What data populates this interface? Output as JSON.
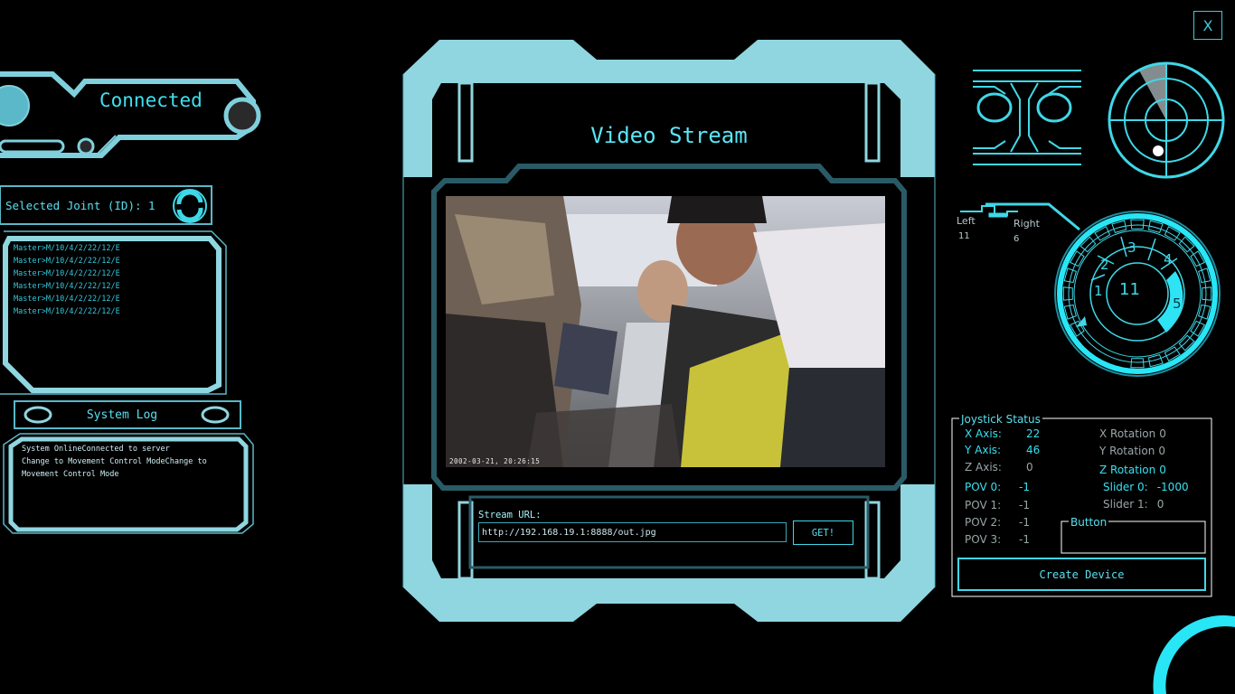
{
  "window": {
    "close_label": "X"
  },
  "connection": {
    "status": "Connected"
  },
  "joint_panel": {
    "selected_label": "Selected Joint (ID): 1",
    "entries": [
      "Master>M/10/4/2/22/12/E",
      "Master>M/10/4/2/22/12/E",
      "Master>M/10/4/2/22/12/E",
      "Master>M/10/4/2/22/12/E",
      "Master>M/10/4/2/22/12/E",
      "Master>M/10/4/2/22/12/E"
    ]
  },
  "system_log": {
    "title": "System Log",
    "lines": [
      "System OnlineConnected to server",
      "Change to Movement Control ModeChange to",
      "Movement Control Mode"
    ]
  },
  "video": {
    "title": "Video Stream",
    "timestamp": "2002-03-21, 20:26:15",
    "url_label": "Stream URL:",
    "url_value": "http://192.168.19.1:8888/out.jpg",
    "get_label": "GET!"
  },
  "motors": {
    "left_label": "Left",
    "left_value": "11",
    "right_label": "Right",
    "right_value": "6"
  },
  "gear_dial": {
    "center_value": "11",
    "gears": [
      "1",
      "2",
      "3",
      "4",
      "5"
    ],
    "active_gear": "5"
  },
  "joystick": {
    "title": "Joystick Status",
    "left_rows": [
      {
        "label": "X Axis:",
        "value": "22",
        "style": "hl"
      },
      {
        "label": "Y Axis:",
        "value": "46",
        "style": "hl"
      },
      {
        "label": "Z Axis:",
        "value": "0",
        "style": "dim"
      },
      {
        "label": "POV 0:",
        "value": "-1",
        "style": "hl"
      },
      {
        "label": "POV 1:",
        "value": "-1",
        "style": "dim"
      },
      {
        "label": "POV 2:",
        "value": "-1",
        "style": "dim"
      },
      {
        "label": "POV 3:",
        "value": "-1",
        "style": "dim"
      }
    ],
    "right_rows": [
      {
        "label": "X Rotation",
        "value": "0",
        "style": "dim"
      },
      {
        "label": "Y Rotation",
        "value": "0",
        "style": "dim"
      },
      {
        "label": "Z Rotation",
        "value": "0",
        "style": "hl"
      },
      {
        "label": "Slider 0:",
        "value": "-1000",
        "style": "hl"
      },
      {
        "label": "Slider 1:",
        "value": "0",
        "style": "dim"
      }
    ],
    "button_group_label": "Button",
    "create_device_label": "Create Device"
  },
  "colors": {
    "accent": "#3fd8e8",
    "frame": "#8fd6e0",
    "background": "#000000"
  }
}
